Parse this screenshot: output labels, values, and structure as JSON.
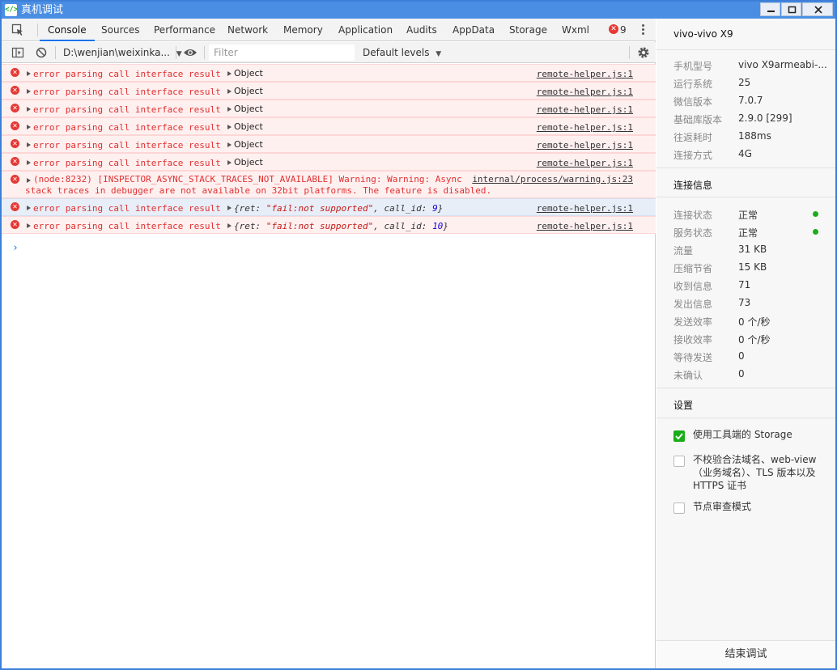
{
  "window": {
    "title": "真机调试",
    "app_icon_text": "</>"
  },
  "tabs": [
    {
      "label": "Console",
      "active": true
    },
    {
      "label": "Sources"
    },
    {
      "label": "Performance"
    },
    {
      "label": "Network"
    },
    {
      "label": "Memory"
    },
    {
      "label": "Application"
    },
    {
      "label": "Audits"
    },
    {
      "label": "AppData"
    },
    {
      "label": "Storage"
    },
    {
      "label": "Wxml"
    }
  ],
  "error_count": "9",
  "toolbar": {
    "context": "D:\\wenjian\\weixinka...",
    "filter_placeholder": "Filter",
    "levels": "Default levels"
  },
  "console": {
    "rows": [
      {
        "message": "error parsing call interface result",
        "object": "Object",
        "source": "remote-helper.js:1"
      },
      {
        "message": "error parsing call interface result",
        "object": "Object",
        "source": "remote-helper.js:1"
      },
      {
        "message": "error parsing call interface result",
        "object": "Object",
        "source": "remote-helper.js:1"
      },
      {
        "message": "error parsing call interface result",
        "object": "Object",
        "source": "remote-helper.js:1"
      },
      {
        "message": "error parsing call interface result",
        "object": "Object",
        "source": "remote-helper.js:1"
      },
      {
        "message": "error parsing call interface result",
        "object": "Object",
        "source": "remote-helper.js:1"
      }
    ],
    "warning": {
      "line1": "(node:8232) [INSPECTOR_ASYNC_STACK_TRACES_NOT_AVAILABLE] Warning: Warning: Async",
      "line2": "stack traces in debugger are not available on 32bit platforms. The feature is disabled.",
      "source": "internal/process/warning.js:23"
    },
    "obj_rows": [
      {
        "message": "error parsing call interface result",
        "prefix": "{ret: ",
        "ret": "\"fail:not supported\"",
        "mid": ", call_id: ",
        "call_id": "9",
        "suffix": "}",
        "source": "remote-helper.js:1"
      },
      {
        "message": "error parsing call interface result",
        "prefix": "{ret: ",
        "ret": "\"fail:not supported\"",
        "mid": ", call_id: ",
        "call_id": "10",
        "suffix": "}",
        "source": "remote-helper.js:1"
      }
    ],
    "prompt": "›"
  },
  "panel": {
    "device_name": "vivo-vivo X9",
    "device_info": [
      {
        "label": "手机型号",
        "value": "vivo X9armeabi-..."
      },
      {
        "label": "运行系统",
        "value": "25"
      },
      {
        "label": "微信版本",
        "value": "7.0.7"
      },
      {
        "label": "基础库版本",
        "value": "2.9.0 [299]"
      },
      {
        "label": "往返耗时",
        "value": "188ms"
      },
      {
        "label": "连接方式",
        "value": "4G"
      }
    ],
    "connection_title": "连接信息",
    "connection_info": [
      {
        "label": "连接状态",
        "value": "正常",
        "dot": true
      },
      {
        "label": "服务状态",
        "value": "正常",
        "dot": true
      },
      {
        "label": "流量",
        "value": "31 KB"
      },
      {
        "label": "压缩节省",
        "value": "15 KB"
      },
      {
        "label": "收到信息",
        "value": "71"
      },
      {
        "label": "发出信息",
        "value": "73"
      },
      {
        "label": "发送效率",
        "value": "0 个/秒"
      },
      {
        "label": "接收效率",
        "value": "0 个/秒"
      },
      {
        "label": "等待发送",
        "value": "0"
      },
      {
        "label": "未确认",
        "value": "0"
      }
    ],
    "settings_title": "设置",
    "settings": [
      {
        "label": "使用工具端的 Storage",
        "checked": true
      },
      {
        "label": "不校验合法域名、web-view（业务域名）、TLS 版本以及 HTTPS 证书",
        "checked": false
      },
      {
        "label": "节点审查模式",
        "checked": false
      }
    ],
    "end_button": "结束调试"
  },
  "colors": {
    "accent": "#1a73e8",
    "error": "#e03030",
    "success": "#1aad19",
    "titlebar": "#4a8ee4"
  }
}
